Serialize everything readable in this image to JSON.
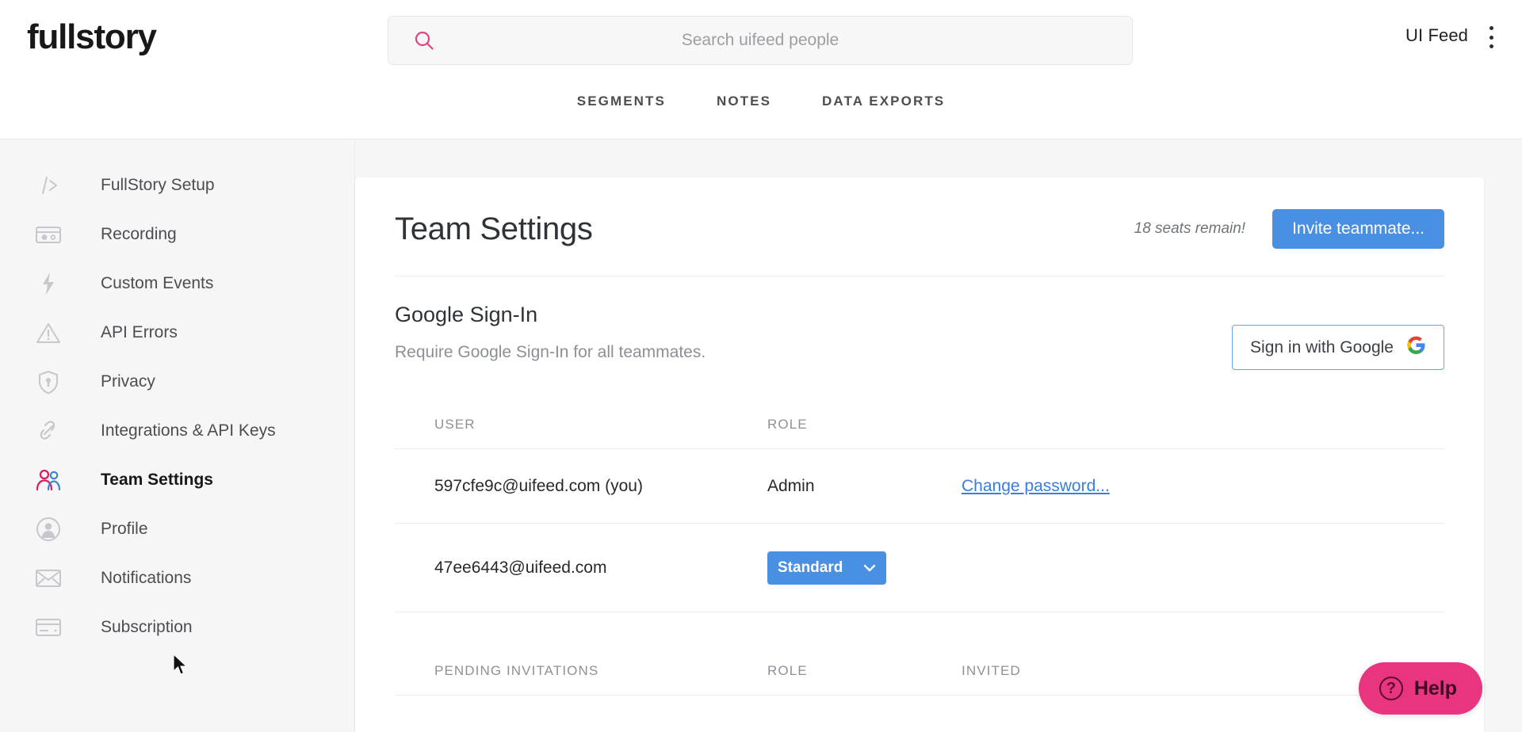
{
  "header": {
    "logo": "fullstory",
    "search": {
      "placeholder": "Search uifeed people",
      "value": "",
      "icon": "search-icon"
    },
    "account_name": "UI Feed",
    "menu_icon": "kebab-menu-icon",
    "nav_tabs": [
      {
        "label": "SEGMENTS"
      },
      {
        "label": "NOTES"
      },
      {
        "label": "DATA EXPORTS"
      }
    ]
  },
  "sidebar": {
    "items": [
      {
        "label": "FullStory Setup",
        "icon": "code-brackets-icon",
        "active": false
      },
      {
        "label": "Recording",
        "icon": "recording-camera-icon",
        "active": false
      },
      {
        "label": "Custom Events",
        "icon": "lightning-bolt-icon",
        "active": false
      },
      {
        "label": "API Errors",
        "icon": "warning-triangle-icon",
        "active": false
      },
      {
        "label": "Privacy",
        "icon": "shield-lock-icon",
        "active": false
      },
      {
        "label": "Integrations & API Keys",
        "icon": "link-chain-icon",
        "active": false
      },
      {
        "label": "Team Settings",
        "icon": "two-people-icon",
        "active": true
      },
      {
        "label": "Profile",
        "icon": "user-circle-icon",
        "active": false
      },
      {
        "label": "Notifications",
        "icon": "envelope-icon",
        "active": false
      },
      {
        "label": "Subscription",
        "icon": "credit-card-icon",
        "active": false
      }
    ]
  },
  "main": {
    "page_title": "Team Settings",
    "seats_remaining": "18 seats remain!",
    "invite_button": "Invite teammate...",
    "google": {
      "title": "Google Sign-In",
      "subtitle": "Require Google Sign-In for all teammates.",
      "button": "Sign in with Google",
      "button_icon": "google-g-icon"
    },
    "members_table": {
      "columns": [
        "USER",
        "ROLE",
        ""
      ],
      "rows": [
        {
          "user": "597cfe9c@uifeed.com (you)",
          "role": "Admin",
          "role_type": "text",
          "action": "Change password..."
        },
        {
          "user": "47ee6443@uifeed.com",
          "role": "Standard",
          "role_type": "select",
          "action": ""
        }
      ]
    },
    "pending_table": {
      "columns": [
        "PENDING INVITATIONS",
        "ROLE",
        "INVITED"
      ],
      "rows": []
    }
  },
  "help": {
    "label": "Help",
    "icon": "question-circle-icon"
  },
  "colors": {
    "accent_pink": "#e9347f",
    "primary_blue": "#4a90e2",
    "link_blue": "#3b7dd8",
    "page_bg": "#f6f6f7",
    "card_bg": "#ffffff",
    "text_dark": "#26292d",
    "text_muted": "#8d9197"
  }
}
